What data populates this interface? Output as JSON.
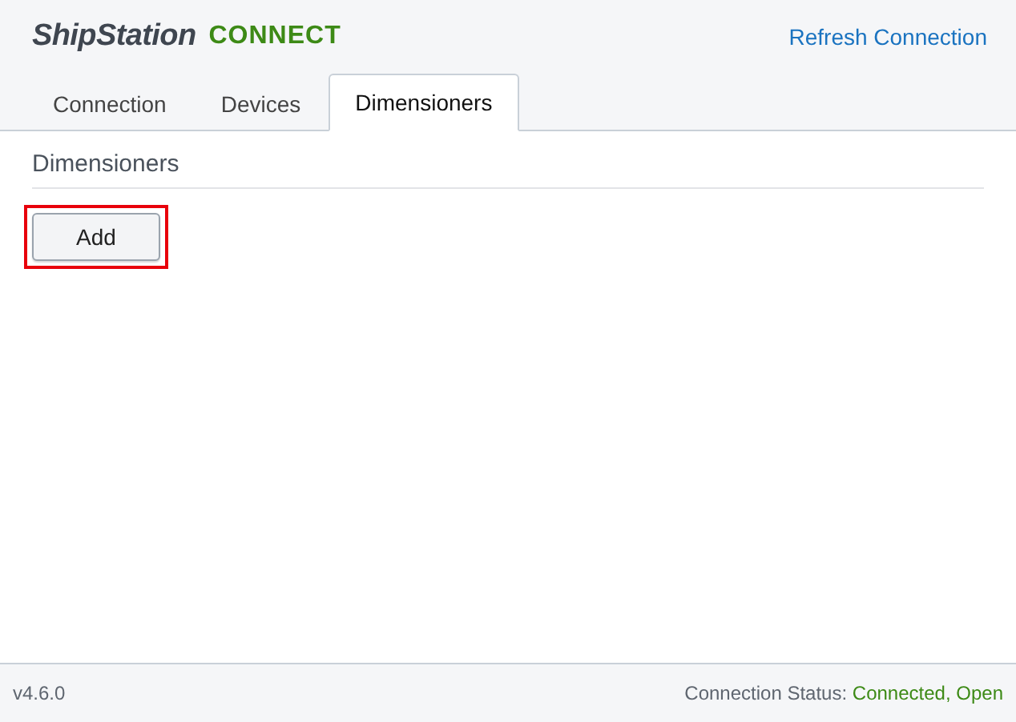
{
  "header": {
    "logo": "ShipStation",
    "logo_accent": "CONNECT",
    "link": "Refresh Connection"
  },
  "tabs": [
    {
      "label": "Connection",
      "selected": false
    },
    {
      "label": "Devices",
      "selected": false
    },
    {
      "label": "Dimensioners",
      "selected": true
    }
  ],
  "section": {
    "title": "Dimensioners",
    "button": {
      "label": "Add",
      "highlighted": true
    }
  },
  "status_bar": {
    "version": "v4.6.0",
    "status_label": "Connection Status:",
    "status_value": "Connected, Open"
  }
}
